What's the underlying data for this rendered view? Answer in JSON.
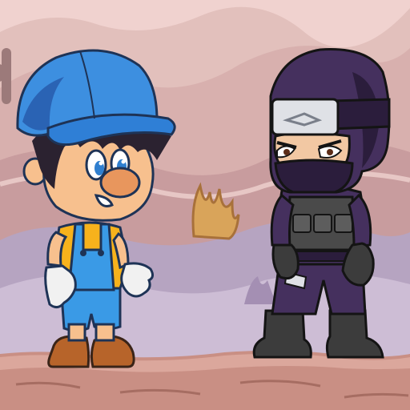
{
  "scene": {
    "setting": "desert-canyon",
    "ground": "rocky-ledge",
    "sky_color": "#f0d2cf",
    "far_hill_color": "#dcb7b3",
    "mid_hill_color": "#c9a0a0",
    "near_hill_color": "#b5a6c0",
    "ground_color": "#c98f84"
  },
  "characters": [
    {
      "role": "hero",
      "palette": {
        "cap": "#3d8fe0",
        "cap_shadow": "#2a63b4",
        "shirt": "#f7b21c",
        "overalls": "#3a9ae6",
        "gloves": "#f1f1f1",
        "boots": "#b7642a",
        "skin": "#f7c08e",
        "nose": "#e8965d"
      }
    },
    {
      "role": "ninja",
      "palette": {
        "suit": "#45305e",
        "suit_dark": "#2b1d3c",
        "headband": "#dfe1e6",
        "vest": "#4a4a4a",
        "boots": "#3c3c3c",
        "skin": "#f2c8a3"
      }
    }
  ]
}
